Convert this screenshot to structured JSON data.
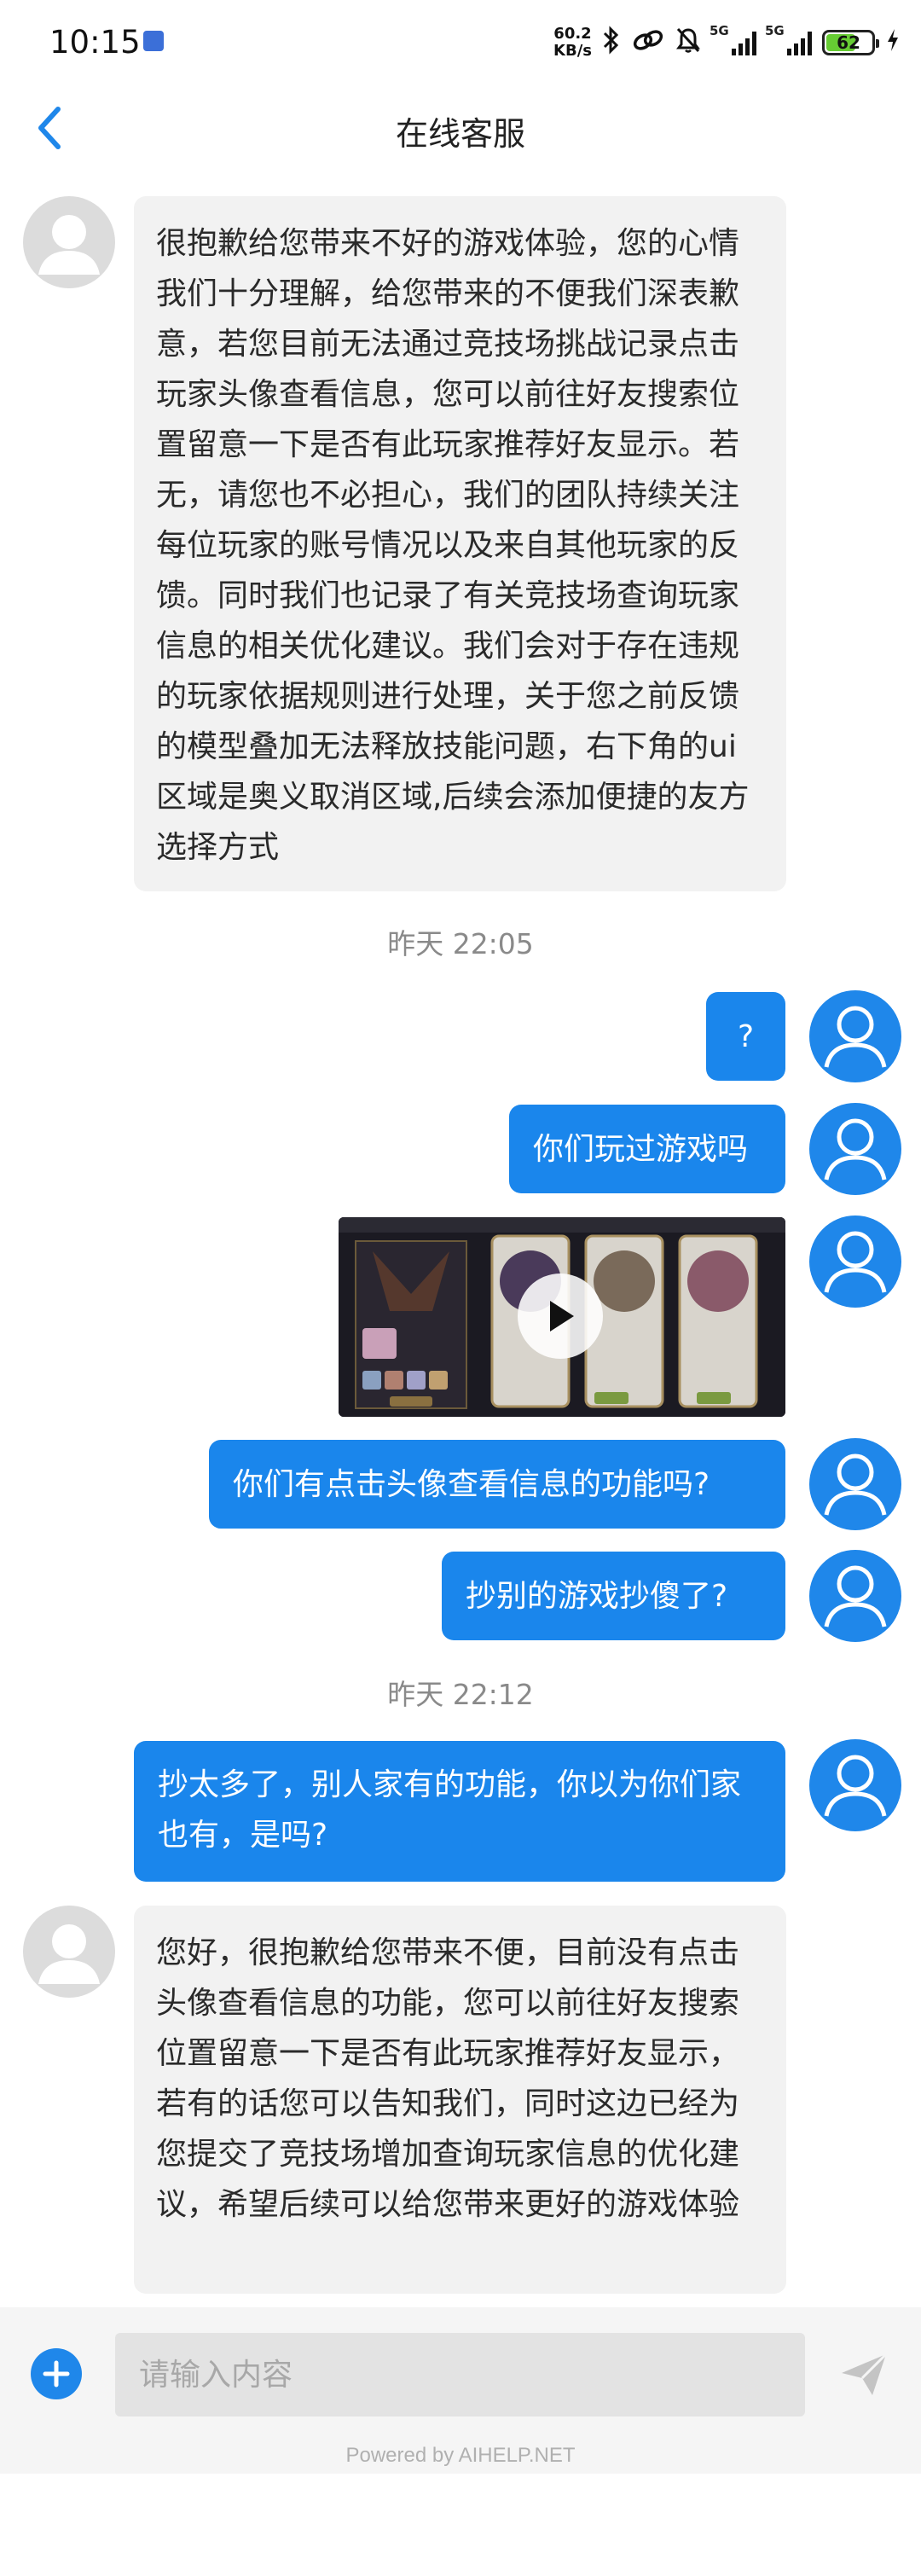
{
  "status_bar": {
    "time": "10:15",
    "net_speed_value": "60.2",
    "net_speed_unit": "KB/s",
    "signal1_label": "5G",
    "signal2_label": "5G",
    "battery": "62",
    "icons": [
      "bluetooth-icon",
      "link-icon",
      "mute-bell-icon",
      "charging-icon"
    ]
  },
  "header": {
    "title": "在线客服"
  },
  "messages": [
    {
      "sender": "agent",
      "text": "很抱歉给您带来不好的游戏体验，您的心情我们十分理解，给您带来的不便我们深表歉意，若您目前无法通过竞技场挑战记录点击玩家头像查看信息，您可以前往好友搜索位置留意一下是否有此玩家推荐好友显示。若无，请您也不必担心，我们的团队持续关注每位玩家的账号情况以及来自其他玩家的反馈。同时我们也记录了有关竞技场查询玩家信息的相关优化建议。我们会对于存在违规的玩家依据规则进行处理，关于您之前反馈的模型叠加无法释放技能问题，右下角的ui区域是奥义取消区域,后续会添加便捷的友方选择方式"
    },
    {
      "timestamp": "昨天 22:05"
    },
    {
      "sender": "user",
      "text": "?"
    },
    {
      "sender": "user",
      "text": "你们玩过游戏吗"
    },
    {
      "sender": "user",
      "type": "video"
    },
    {
      "sender": "user",
      "text": "你们有点击头像查看信息的功能吗?"
    },
    {
      "sender": "user",
      "text": "抄别的游戏抄傻了?"
    },
    {
      "timestamp": "昨天 22:12"
    },
    {
      "sender": "user",
      "text": "抄太多了，别人家有的功能，你以为你们家也有，是吗?"
    },
    {
      "sender": "agent",
      "text": "您好，很抱歉给您带来不便，目前没有点击头像查看信息的功能，您可以前往好友搜索位置留意一下是否有此玩家推荐好友显示，若有的话您可以告知我们，同时这边已经为您提交了竞技场增加查询玩家信息的优化建议，希望后续可以给您带来更好的游戏体验"
    }
  ],
  "input": {
    "placeholder": "请输入内容",
    "value": ""
  },
  "footer": {
    "powered_by": "Powered by AIHELP.NET"
  },
  "colors": {
    "accent": "#1a86ec",
    "agent_bubble": "#f2f2f2",
    "timestamp": "#8a8a8a"
  }
}
